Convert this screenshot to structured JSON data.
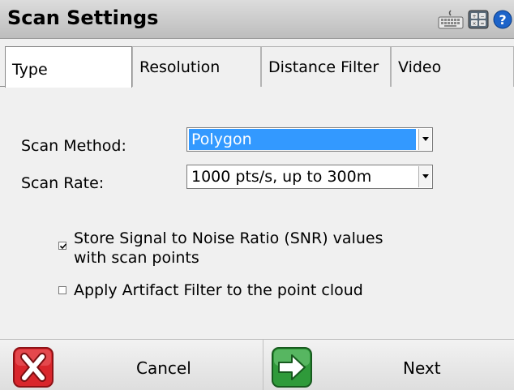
{
  "window": {
    "title": "Scan Settings"
  },
  "titlebar_icons": [
    "keyboard-icon",
    "calculator-icon",
    "help-icon"
  ],
  "tabs": [
    {
      "label": "Type",
      "active": true
    },
    {
      "label": "Resolution",
      "active": false
    },
    {
      "label": "Distance Filter",
      "active": false
    },
    {
      "label": "Video",
      "active": false
    }
  ],
  "form": {
    "scan_method": {
      "label": "Scan Method:",
      "value": "Polygon"
    },
    "scan_rate": {
      "label": "Scan Rate:",
      "value": "1000 pts/s, up to 300m"
    },
    "snr": {
      "line1": "Store Signal to Noise Ratio (SNR) values",
      "line2": "with scan points",
      "checked": true
    },
    "artifact": {
      "label": "Apply Artifact Filter to the point cloud",
      "checked": false
    }
  },
  "footer": {
    "cancel_label": "Cancel",
    "next_label": "Next"
  },
  "colors": {
    "selection": "#3399ff",
    "cancel_red": "#d9262c",
    "next_green": "#2f9a3a",
    "help_blue": "#1c63c9"
  }
}
